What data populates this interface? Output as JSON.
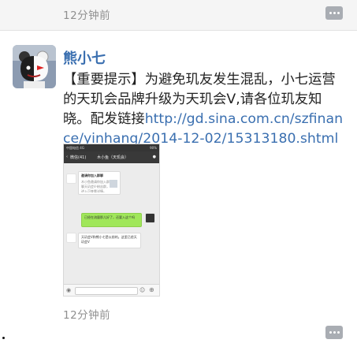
{
  "top": {
    "timestamp": "12分钟前"
  },
  "post": {
    "author": "熊小七",
    "text": "【重要提示】为避免玑友发生混乱，小七运营的天玑会品牌升级为天玑会V,请各位玑友知晓。配发链接",
    "link": "http://gd.sina.com.cn/szfinance/yinhang/2014-12-02/15313180.shtml",
    "timestamp": "12分钟前"
  },
  "screenshot": {
    "status_left": "中国电信 4G",
    "status_right": "90%",
    "header_back": "微信(41)",
    "header_title": "木小鱼（天玑会）",
    "msg1_title": "邀请你加入群聊",
    "msg1_body": "木小鱼邀请你加入群聊天玑会V-粉丝群，进入可查看详情。",
    "msg2": "已经在流量那儿好了，还要入这个吗",
    "msg3": "天玑会V和熊小七是以前的。这里已经天玑会V"
  },
  "colors": {
    "link": "#3a6fb0",
    "name": "#3a6fb0",
    "text": "#222222",
    "timestamp": "#8f8f8f",
    "green_bubble": "#a0e75a"
  },
  "icons": [
    "more-menu-icon",
    "avatar-bear-icon",
    "back-arrow-icon",
    "person-icon",
    "emoji-icon",
    "plus-icon",
    "voice-icon"
  ]
}
